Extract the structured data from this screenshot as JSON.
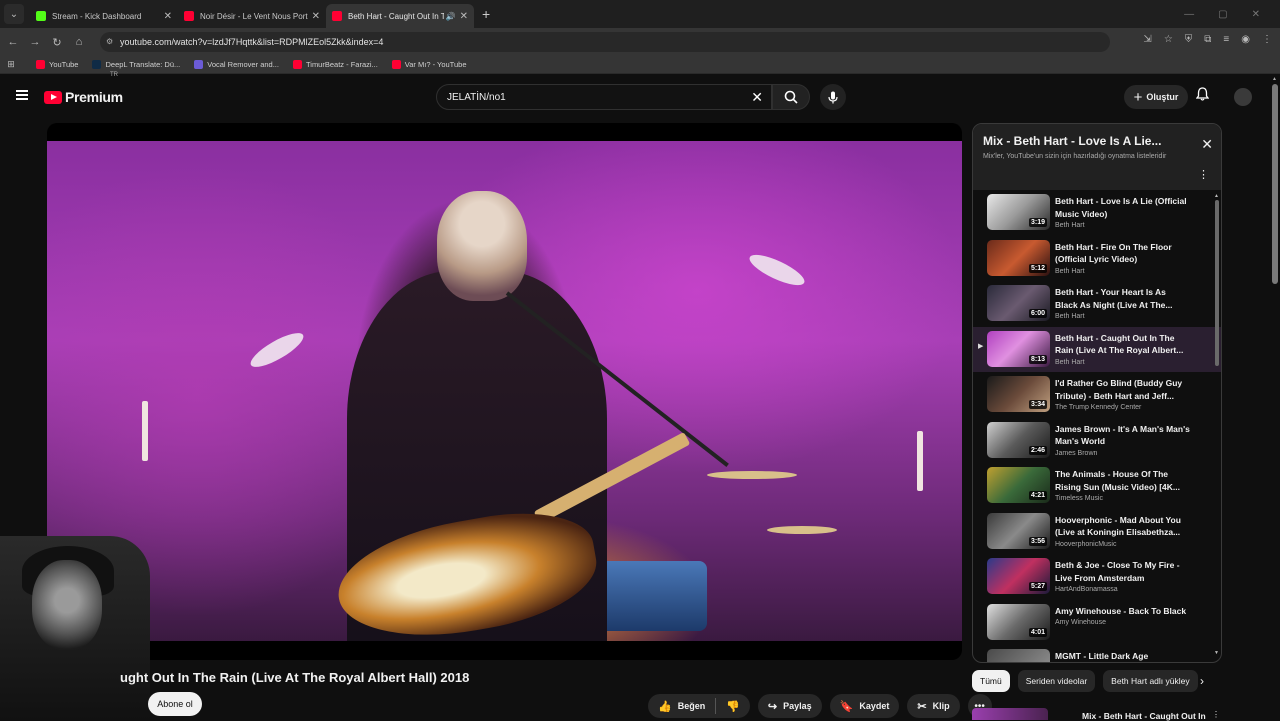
{
  "browser": {
    "tabs": [
      {
        "title": "Stream - Kick Dashboard",
        "color": "#53fc18",
        "active": false
      },
      {
        "title": "Noir Désir - Le Vent Nous Porte",
        "color": "#ff0033",
        "active": false
      },
      {
        "title": "Beth Hart - Caught Out In T",
        "color": "#ff0033",
        "active": true
      }
    ],
    "url": "youtube.com/watch?v=lzdJf7Hqttk&list=RDPMlZEol5Zkk&index=4",
    "bookmarks": [
      {
        "label": "YouTube",
        "color": "#ff0033"
      },
      {
        "label": "DeepL Translate: Dü...",
        "color": "#0f2b46"
      },
      {
        "label": "Vocal Remover and...",
        "color": "#6b5bd6"
      },
      {
        "label": "TimurBeatz - Farazi...",
        "color": "#ff0033"
      },
      {
        "label": "Var Mı? - YouTube",
        "color": "#ff0033"
      }
    ]
  },
  "header": {
    "logo_text": "Premium",
    "country_code": "TR",
    "search_value": "JELATİN/no1",
    "create_label": "Oluştur"
  },
  "video": {
    "title": "ught Out In The Rain (Live At The Royal Albert Hall) 2018",
    "subscribe_label": "Abone ol",
    "actions": {
      "like": "Beğen",
      "share": "Paylaş",
      "save": "Kaydet",
      "clip": "Klip"
    }
  },
  "playlist": {
    "title": "Mix - Beth Hart - Love Is A Lie...",
    "subtitle": "Mix'ler, YouTube'un sizin için hazırladığı oynatma listeleridir",
    "items": [
      {
        "title": "Beth Hart - Love Is A Lie (Official Music Video)",
        "channel": "Beth Hart",
        "duration": "3:19",
        "thumb": "linear-gradient(135deg,#e8e8e8,#9a9a9a 50%,#2a2a2a)"
      },
      {
        "title": "Beth Hart - Fire On The Floor (Official Lyric Video)",
        "channel": "Beth Hart",
        "duration": "5:12",
        "thumb": "linear-gradient(135deg,#6a2a1a,#c85a30 50%,#2a1010)"
      },
      {
        "title": "Beth Hart - Your Heart Is As Black As Night (Live At The...",
        "channel": "Beth Hart",
        "duration": "6:00",
        "thumb": "linear-gradient(135deg,#2a2a3a,#6a5a70 50%,#1a1a22)"
      },
      {
        "title": "Beth Hart - Caught Out In The Rain (Live At The Royal Albert...",
        "channel": "Beth Hart",
        "duration": "8:13",
        "thumb": "linear-gradient(135deg,#b040c0,#e090e0 45%,#3a1a40)",
        "current": true
      },
      {
        "title": "I'd Rather Go Blind (Buddy Guy Tribute) - Beth Hart and Jeff...",
        "channel": "The Trump Kennedy Center",
        "duration": "3:34",
        "thumb": "linear-gradient(135deg,#1a1a1a,#6a4a3a 50%,#c0a080)"
      },
      {
        "title": "James Brown - It's A Man's Man's Man's World",
        "channel": "James Brown",
        "duration": "2:46",
        "thumb": "linear-gradient(135deg,#d0d0d0,#5a5a5a 50%,#1a1a1a)"
      },
      {
        "title": "The Animals - House Of The Rising Sun (Music Video) [4K...",
        "channel": "Timeless Music",
        "duration": "4:21",
        "thumb": "linear-gradient(135deg,#c0a030,#3a6a3a 50%,#1a2a1a)"
      },
      {
        "title": "Hooverphonic - Mad About You (Live at Koningin Elisabethza...",
        "channel": "HooverphonicMusic",
        "duration": "3:56",
        "thumb": "linear-gradient(135deg,#3a3a3a,#8a8a8a 50%,#1a1a1a)"
      },
      {
        "title": "Beth & Joe - Close To My Fire - Live From Amsterdam",
        "channel": "HartAndBonamassa",
        "duration": "5:27",
        "thumb": "linear-gradient(135deg,#2a3a8a,#c03060 50%,#1a1a3a)"
      },
      {
        "title": "Amy Winehouse - Back To Black",
        "channel": "Amy Winehouse",
        "duration": "4:01",
        "thumb": "linear-gradient(135deg,#e0e0e0,#6a6a6a 50%,#1a1a1a)"
      },
      {
        "title": "MGMT - Little Dark Age",
        "channel": "",
        "duration": "",
        "thumb": "linear-gradient(135deg,#4a4a4a,#9a9a9a)"
      }
    ]
  },
  "chips": [
    {
      "label": "Tümü",
      "active": true
    },
    {
      "label": "Seriden videolar",
      "active": false
    },
    {
      "label": "Beth Hart adlı yükley",
      "active": false
    }
  ],
  "next": {
    "title": "Mix - Beth Hart - Caught Out In"
  }
}
